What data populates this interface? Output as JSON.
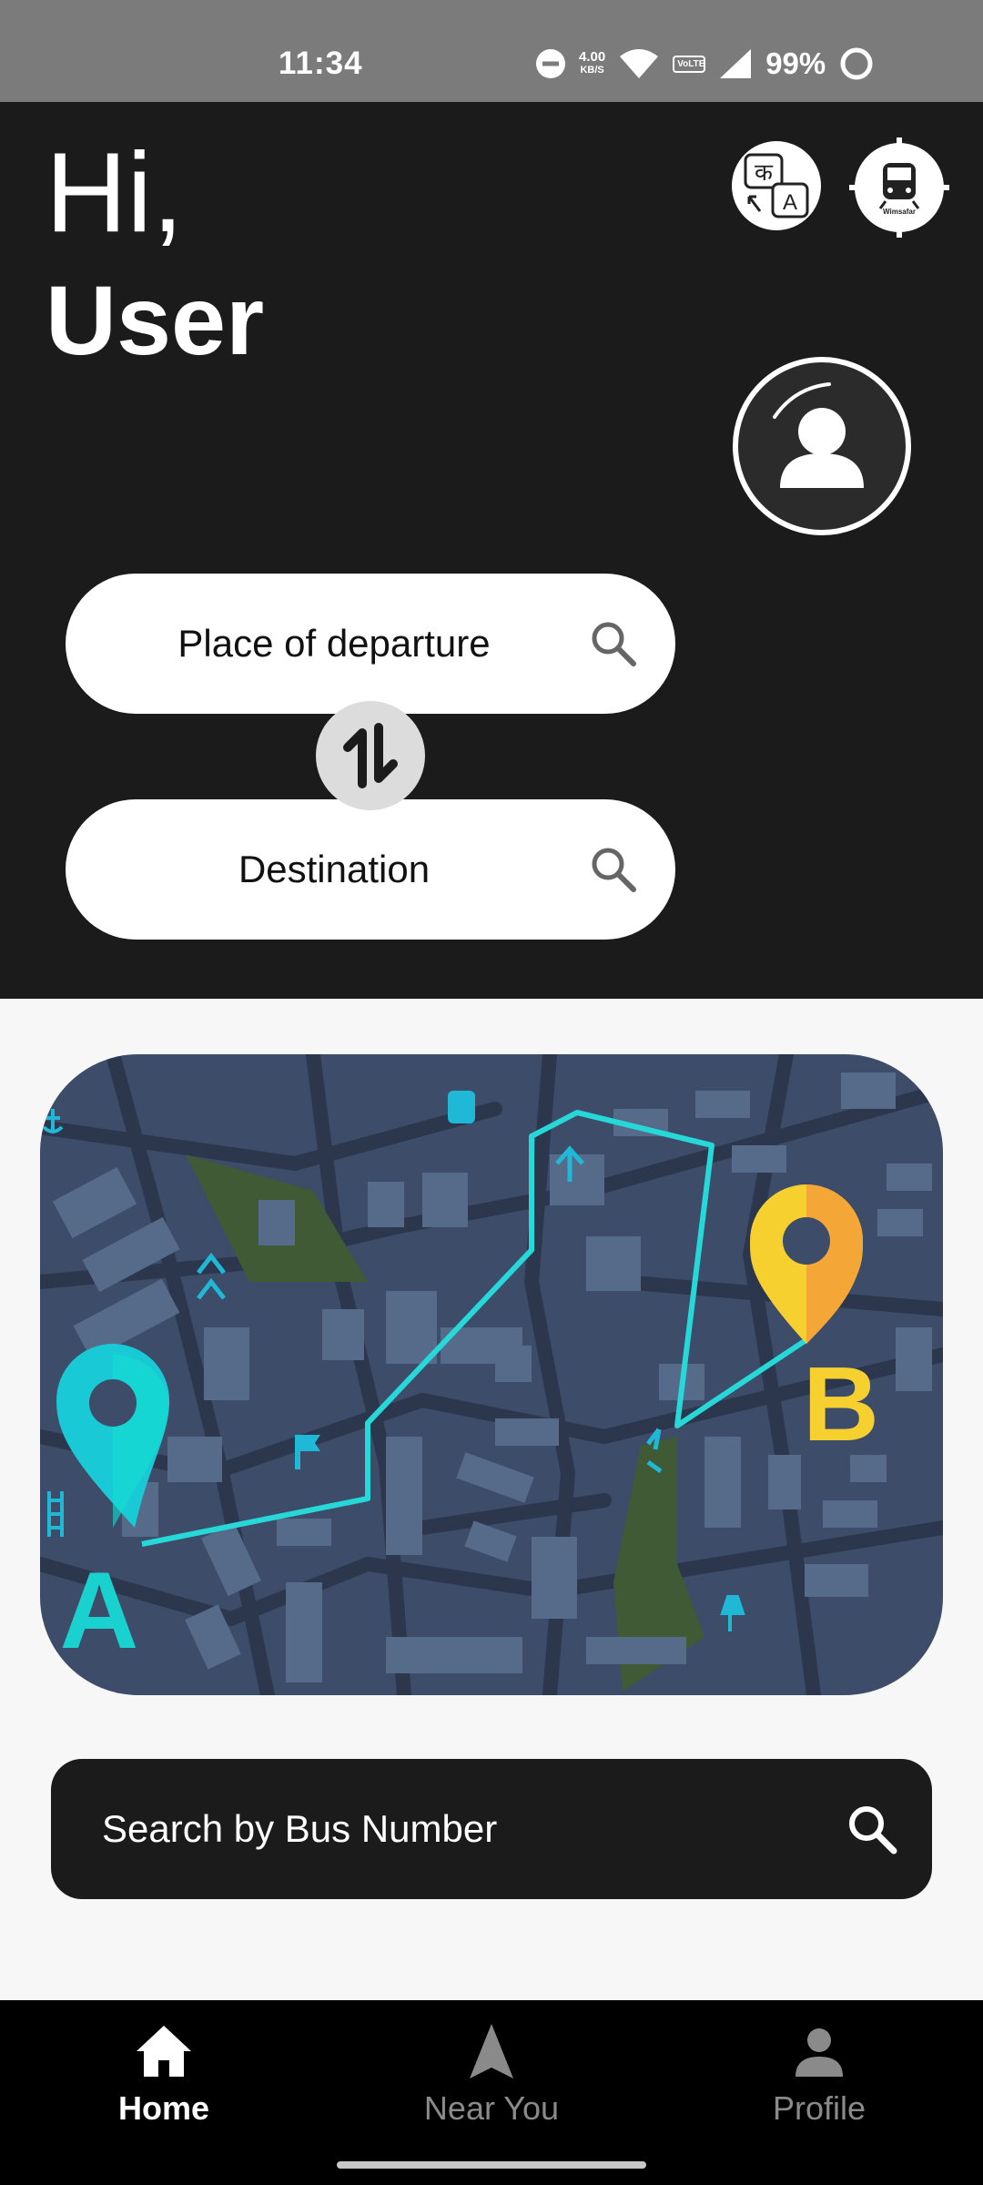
{
  "status_bar": {
    "time": "11:34",
    "network_speed_value": "4.00",
    "network_speed_unit": "KB/S",
    "volte": "VoLTE",
    "battery": "99%",
    "icons": [
      "dnd-icon",
      "wifi-icon",
      "volte-icon",
      "signal-icon",
      "battery-ring-icon"
    ]
  },
  "header": {
    "greeting": "Hi,",
    "user_name": "User",
    "translate_icon_glyph_1": "क",
    "translate_icon_glyph_2": "A",
    "train_icon_caption": "Wimsafar"
  },
  "trip_search": {
    "departure_placeholder": "Place of departure",
    "destination_placeholder": "Destination"
  },
  "map": {
    "marker_start": "A",
    "marker_end": "B",
    "colors": {
      "background": "#3b4a66",
      "route": "#27d8d8",
      "marker_a": "#19c9d6",
      "marker_b": "#f6d02f"
    }
  },
  "bus_search": {
    "label": "Search by Bus Number"
  },
  "bottom_nav": {
    "items": [
      {
        "label": "Home",
        "icon": "home-icon",
        "active": true
      },
      {
        "label": "Near You",
        "icon": "navigation-arrow-icon",
        "active": false
      },
      {
        "label": "Profile",
        "icon": "person-icon",
        "active": false
      }
    ]
  }
}
